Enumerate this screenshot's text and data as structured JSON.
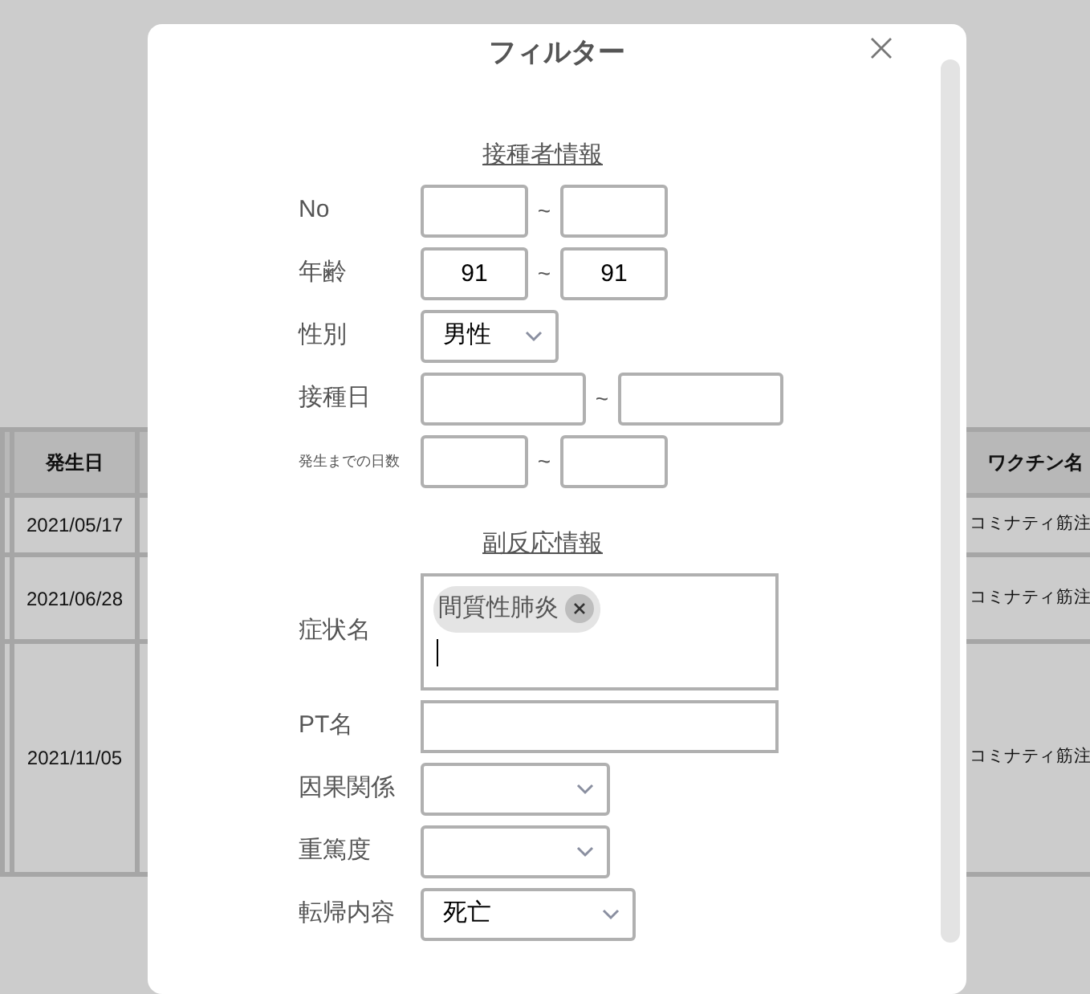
{
  "background_table": {
    "columns": [
      "発生日",
      "ワクチン名"
    ],
    "rows": [
      [
        "2021/05/17",
        "コミナティ筋注"
      ],
      [
        "2021/06/28",
        "コミナティ筋注"
      ],
      [
        "2021/11/05",
        "コミナティ筋注"
      ]
    ]
  },
  "modal": {
    "title": "フィルター",
    "sections": [
      {
        "heading": "接種者情報",
        "fields": [
          {
            "kind": "range",
            "label": "No",
            "separator": "~"
          },
          {
            "kind": "range",
            "label": "年齢",
            "from": "91",
            "separator": "~",
            "to": "91"
          },
          {
            "kind": "select",
            "label": "性別",
            "value": "男性"
          },
          {
            "kind": "date_range",
            "label": "接種日",
            "separator": "~"
          },
          {
            "kind": "range",
            "label": "発生までの日数",
            "small_label": true,
            "separator": "~"
          }
        ]
      },
      {
        "heading": "副反応情報",
        "fields": [
          {
            "kind": "tags",
            "label": "症状名",
            "tags": [
              "間質性肺炎"
            ]
          },
          {
            "kind": "text",
            "label": "PT名"
          },
          {
            "kind": "select",
            "label": "因果関係"
          },
          {
            "kind": "select",
            "label": "重篤度"
          },
          {
            "kind": "select",
            "label": "転帰内容",
            "value": "死亡"
          }
        ]
      }
    ]
  }
}
